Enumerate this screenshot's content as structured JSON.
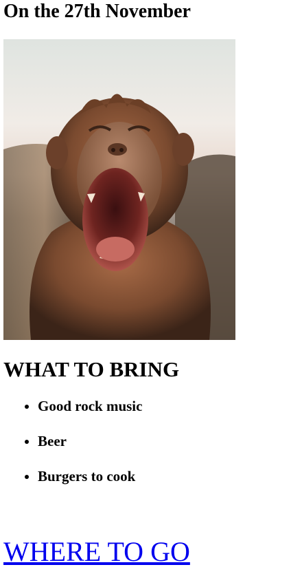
{
  "header": {
    "date_heading": "On the 27th November"
  },
  "hero_image": {
    "subject": "monkey-yawning-photo"
  },
  "bring_section": {
    "heading": "WHAT TO BRING",
    "items": [
      {
        "label": "Good rock music"
      },
      {
        "label": "Beer"
      },
      {
        "label": "Burgers to cook"
      }
    ]
  },
  "where_section": {
    "link_text": "WHERE TO GO"
  },
  "colors": {
    "link": "#0000ee",
    "text": "#000000",
    "background": "#ffffff"
  }
}
